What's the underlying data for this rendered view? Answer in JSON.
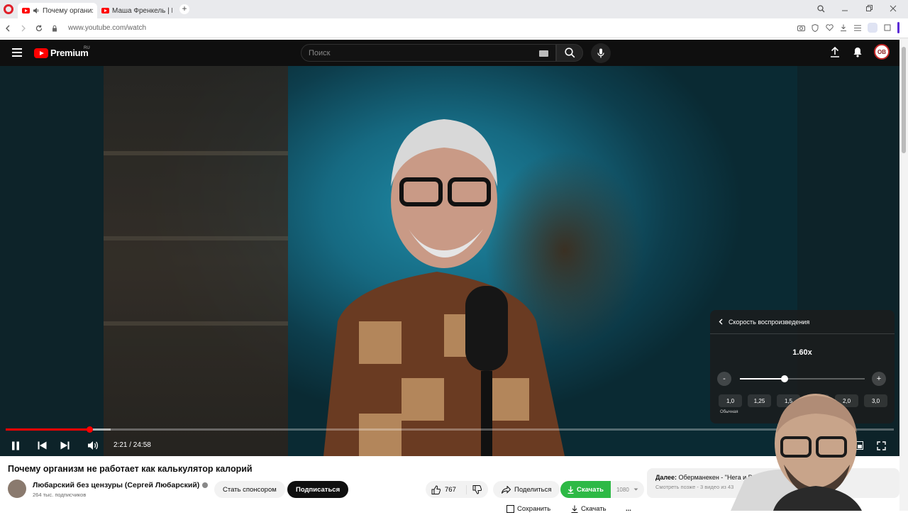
{
  "browser": {
    "tabs": [
      {
        "label": "Почему организм не",
        "active": true
      },
      {
        "label": "Маша Френкель | Школ",
        "active": false
      }
    ],
    "url": "www.youtube.com/watch"
  },
  "youtube": {
    "logo_text": "Premium",
    "logo_region": "RU",
    "search_placeholder": "Поиск",
    "avatar_initials": "ОВ"
  },
  "player": {
    "time_display": "2:21 / 24:58",
    "progress_fraction": 0.094,
    "buffered_fraction": 0.118,
    "speed_panel": {
      "title": "Скорость воспроизведения",
      "current_value": "1.60x",
      "slider_fraction": 0.36,
      "minus_label": "-",
      "plus_label": "+",
      "presets": [
        "1,0",
        "1,25",
        "1,5",
        "",
        "2,0",
        "3,0"
      ],
      "normal_label": "Обычная"
    }
  },
  "video": {
    "title": "Почему организм не работает как калькулятор калорий",
    "channel_name": "Любарский без цензуры (Сергей Любарский)",
    "subscribers": "264 тыс. подписчиков",
    "sponsor_label": "Стать спонсором",
    "subscribe_label": "Подписаться",
    "likes": "767",
    "share_label": "Поделиться",
    "download_label": "Скачать",
    "download_quality": "1080",
    "save_label": "Сохранить",
    "download2_label": "Скачать",
    "more_label": "..."
  },
  "next_up": {
    "prefix": "Далее:",
    "title": "Оберманекен - \"Нега и Роскошь\"",
    "subtitle": "Смотреть позже - 3 видео из 43"
  },
  "colors": {
    "youtube_red": "#ff0000",
    "download_green": "#2db945",
    "masthead_bg": "#0f0f0f"
  }
}
